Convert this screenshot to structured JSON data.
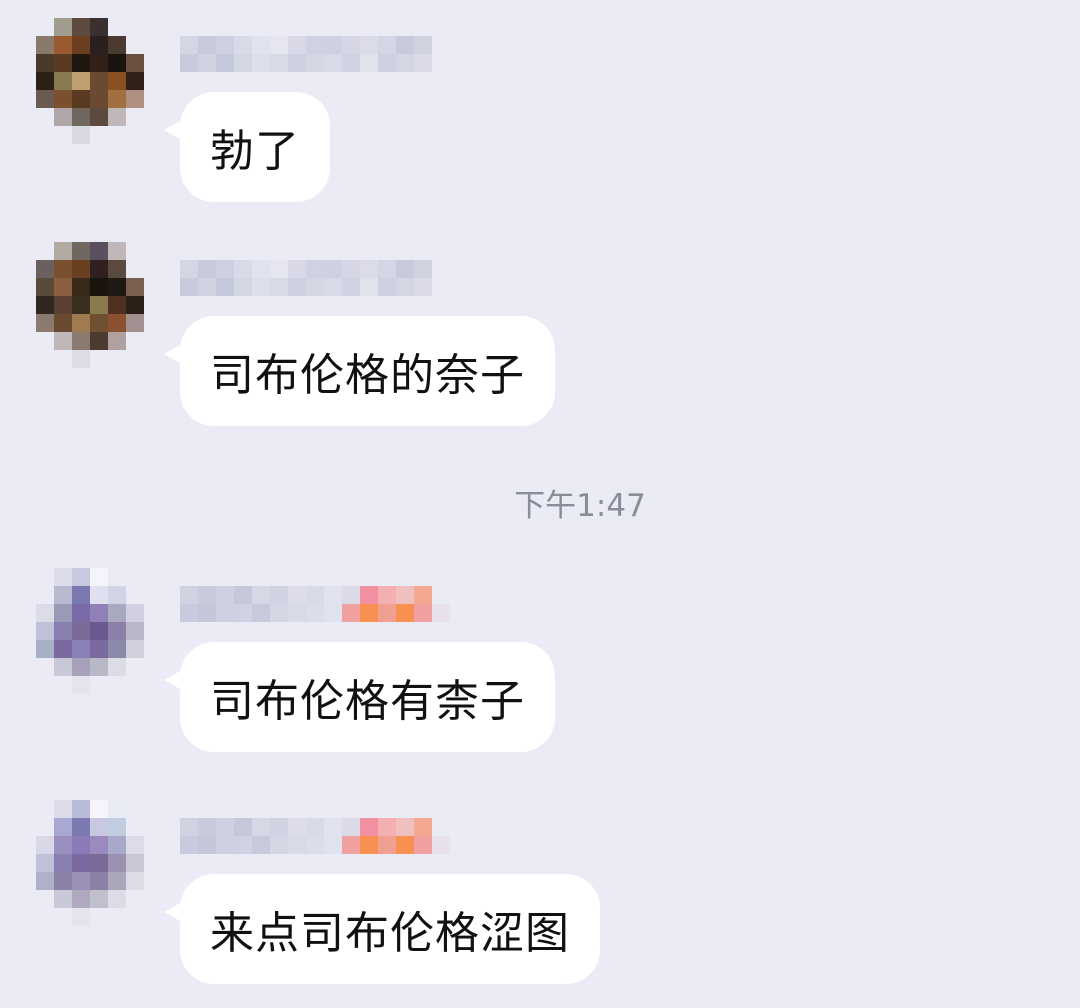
{
  "colors": {
    "background": "#ebebf5",
    "bubble": "#ffffff",
    "text": "#111111",
    "timestamp": "#8a8c98"
  },
  "messages": [
    {
      "text": "勃了",
      "avatar_style": "brown",
      "name_style": "plain"
    },
    {
      "text": "司布伦格的奈子",
      "avatar_style": "brown",
      "name_style": "plain"
    },
    {
      "text": "司布伦格有柰子",
      "avatar_style": "purple",
      "name_style": "colored"
    },
    {
      "text": "来点司布伦格涩图",
      "avatar_style": "purple",
      "name_style": "colored"
    }
  ],
  "timestamp": "下午1:47"
}
